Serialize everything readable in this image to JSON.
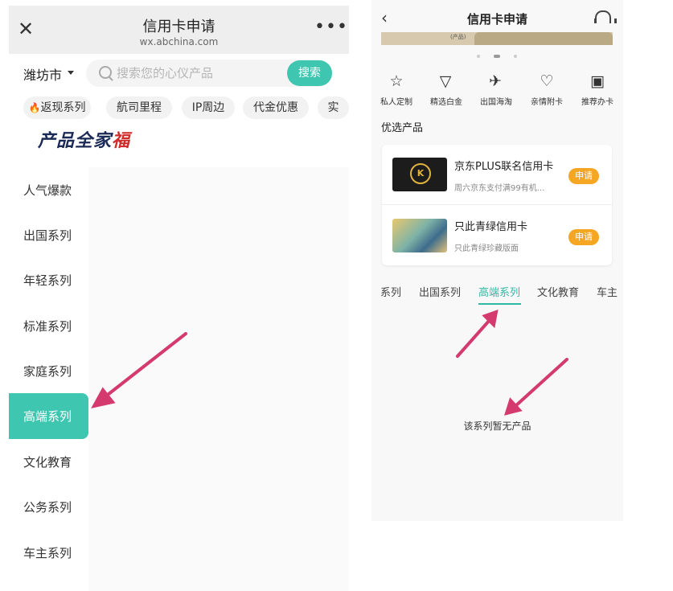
{
  "colors": {
    "accent": "#3ec6b1",
    "tab_accent": "#2fb9a4",
    "apply_orange": "#f5a623",
    "arrow": "#d43a6e"
  },
  "left": {
    "header": {
      "title": "信用卡申请",
      "url": "wx.abchina.com",
      "close_icon": "close-icon",
      "more_icon": "more-dots-icon"
    },
    "city": "潍坊市",
    "search": {
      "placeholder": "搜索您的心仪产品",
      "button": "搜索"
    },
    "tags": [
      "返现系列",
      "航司里程",
      "IP周边",
      "代金优惠",
      "实"
    ],
    "brand": {
      "text": "产品全家",
      "accent": "福"
    },
    "sidebar": [
      "人气爆款",
      "出国系列",
      "年轻系列",
      "标准系列",
      "家庭系列",
      "高端系列",
      "文化教育",
      "公务系列",
      "车主系列"
    ],
    "sidebar_active_index": 5
  },
  "right": {
    "header": {
      "title": "信用卡申请",
      "back_icon": "back-icon",
      "service_icon": "headset-icon"
    },
    "banner_tag": "(产品)",
    "categories": [
      {
        "icon": "star-icon",
        "label": "私人定制"
      },
      {
        "icon": "diamond-icon",
        "label": "精选白金"
      },
      {
        "icon": "plane-icon",
        "label": "出国海淘"
      },
      {
        "icon": "heart-card-icon",
        "label": "亲情附卡"
      },
      {
        "icon": "recommend-icon",
        "label": "推荐办卡"
      }
    ],
    "section_title": "优选产品",
    "products": [
      {
        "name": "京东PLUS联名信用卡",
        "desc": "周六京东支付满99有机...",
        "apply": "申请"
      },
      {
        "name": "只此青绿信用卡",
        "desc": "只此青绿珍藏版面",
        "apply": "申请"
      }
    ],
    "tabs": [
      "系列",
      "出国系列",
      "高端系列",
      "文化教育",
      "车主"
    ],
    "active_tab_index": 2,
    "empty_message": "该系列暂无产品"
  }
}
